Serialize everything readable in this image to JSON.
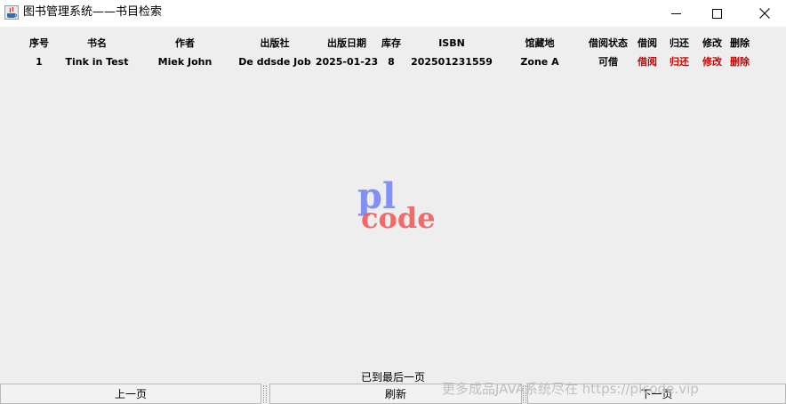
{
  "window": {
    "title": "图书管理系统——书目检索"
  },
  "table": {
    "columns": [
      "序号",
      "书名",
      "作者",
      "出版社",
      "出版日期",
      "库存",
      "ISBN",
      "馆藏地",
      "借阅状态",
      "借阅",
      "归还",
      "修改",
      "删除"
    ],
    "rows": [
      {
        "index": "1",
        "title": "Tink in Test",
        "author": "Miek John",
        "publisher": "De ddsde Job",
        "pub_date": "2025-01-23",
        "stock": "8",
        "isbn": "202501231559",
        "location": "Zone A",
        "status": "可借",
        "borrow": "借阅",
        "return": "归还",
        "edit": "修改",
        "delete": "删除"
      }
    ]
  },
  "watermark": {
    "top": "pl",
    "bottom": "code",
    "color_top": "#6d7ff2",
    "color_bottom": "#f25b5b"
  },
  "status": {
    "message": "已到最后一页"
  },
  "buttons": {
    "prev": "上一页",
    "refresh": "刷新",
    "next": "下一页"
  },
  "footer_watermark": "更多成品JAVA系统尽在 https://plcode.vip"
}
